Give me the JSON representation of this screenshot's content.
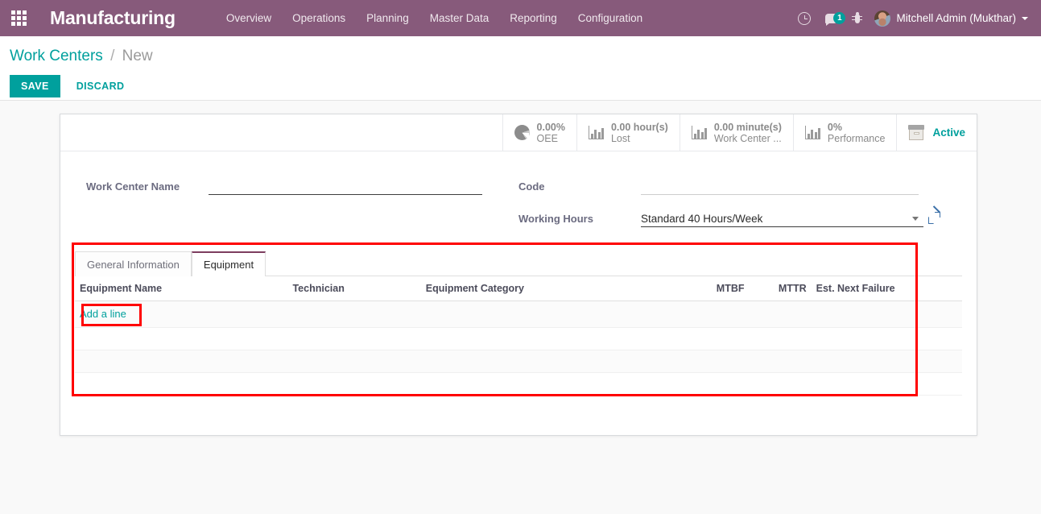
{
  "navbar": {
    "apps_icon": "apps-grid-icon",
    "brand": "Manufacturing",
    "menu": [
      {
        "label": "Overview"
      },
      {
        "label": "Operations"
      },
      {
        "label": "Planning"
      },
      {
        "label": "Master Data"
      },
      {
        "label": "Reporting"
      },
      {
        "label": "Configuration"
      }
    ],
    "icons": {
      "clock": "clock-icon",
      "chat": "chat-bubble-icon",
      "chat_badge": "1",
      "bug": "bug-icon",
      "avatar": "user-avatar"
    },
    "user": "Mitchell Admin (Mukthar)"
  },
  "control_panel": {
    "breadcrumb_root": "Work Centers",
    "breadcrumb_sep": "/",
    "breadcrumb_current": "New",
    "save_label": "SAVE",
    "discard_label": "DISCARD"
  },
  "stat_buttons": [
    {
      "icon": "pie-chart-icon",
      "value": "0.00%",
      "label": "OEE"
    },
    {
      "icon": "bar-chart-icon",
      "value": "0.00 hour(s)",
      "label": "Lost"
    },
    {
      "icon": "bar-chart-icon",
      "value": "0.00 minute(s)",
      "label": "Work Center ..."
    },
    {
      "icon": "bar-chart-icon",
      "value": "0%",
      "label": "Performance"
    },
    {
      "icon": "archive-box-icon",
      "value": "Active",
      "label": ""
    }
  ],
  "form": {
    "work_center_name": {
      "label": "Work Center Name",
      "value": "",
      "placeholder": ""
    },
    "code": {
      "label": "Code",
      "value": "",
      "placeholder": ""
    },
    "working_hours": {
      "label": "Working Hours",
      "value": "Standard 40 Hours/Week",
      "external_link": "internal-link-icon"
    }
  },
  "notebook": {
    "tabs": [
      {
        "label": "General Information",
        "active": false
      },
      {
        "label": "Equipment",
        "active": true
      }
    ],
    "table": {
      "columns": [
        "Equipment Name",
        "Technician",
        "Equipment Category",
        "MTBF",
        "MTTR",
        "Est. Next Failure"
      ],
      "rows": [],
      "add_line_label": "Add a line"
    }
  },
  "colors": {
    "brand_purple": "#875A7B",
    "teal": "#00A09D",
    "annotation_red": "#ff0000",
    "tab_active_border": "#7d3d5f"
  }
}
